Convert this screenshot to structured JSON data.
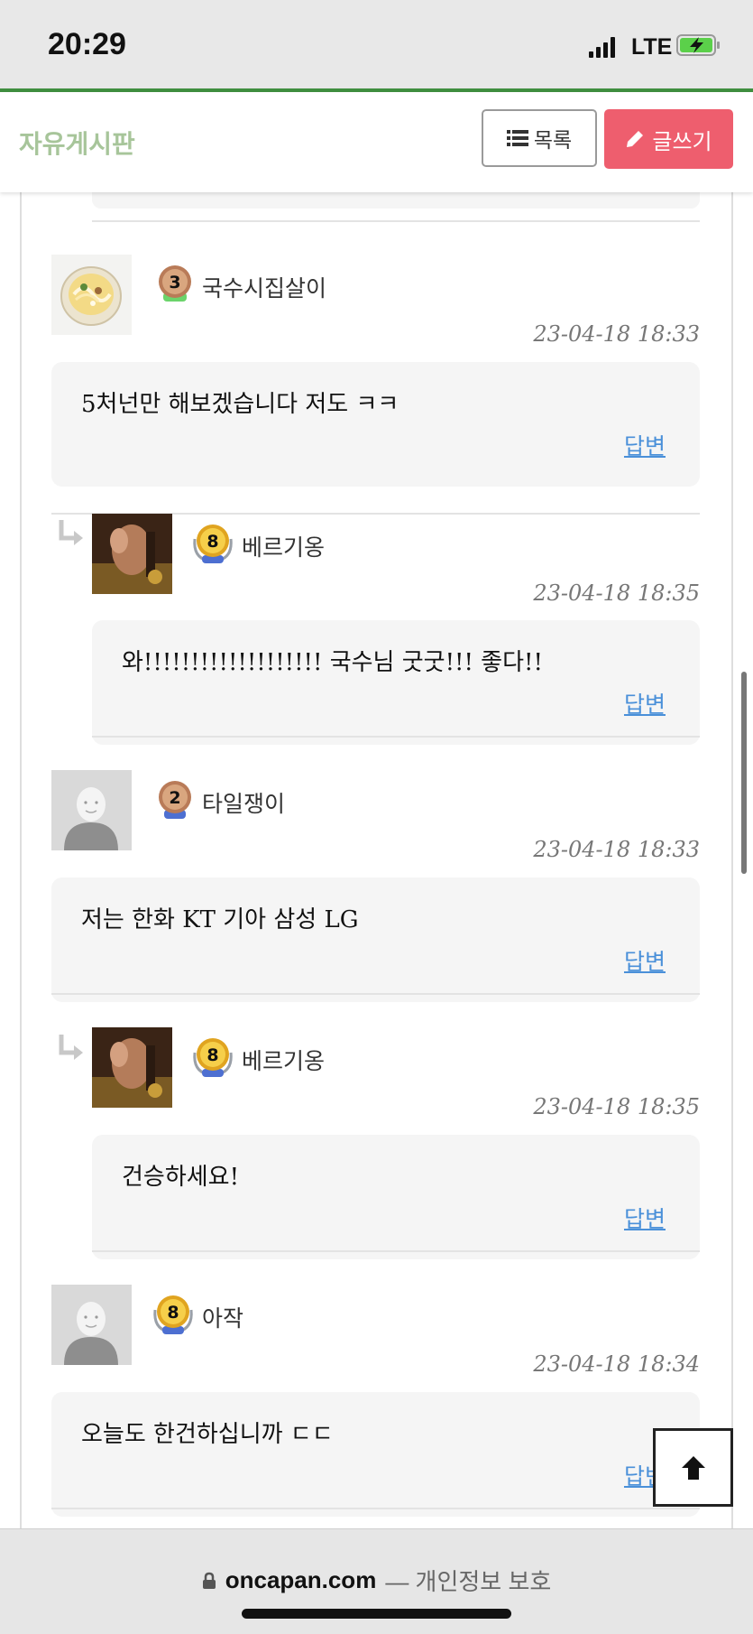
{
  "status_bar": {
    "time": "20:29",
    "network": "LTE"
  },
  "header": {
    "title": "자유게시판",
    "list_label": "목록",
    "write_label": "글쓰기"
  },
  "comments": [
    {
      "author": "국수시집살이",
      "level": "3",
      "date": "23-04-18 18:33",
      "text": "5처넌만 해보겠습니다 저도 ㅋㅋ",
      "reply_label": "답변",
      "avatar": "noodle-bowl",
      "is_reply": false
    },
    {
      "author": "베르기옹",
      "level": "8",
      "date": "23-04-18 18:35",
      "text": "와!!!!!!!!!!!!!!!!!!! 국수님 굿굿!!! 좋다!!",
      "reply_label": "답변",
      "avatar": "photo-hands",
      "is_reply": true
    },
    {
      "author": "타일쟁이",
      "level": "2",
      "date": "23-04-18 18:33",
      "text": "저는 한화 KT 기아 삼성 LG",
      "reply_label": "답변",
      "avatar": "default-user",
      "is_reply": false
    },
    {
      "author": "베르기옹",
      "level": "8",
      "date": "23-04-18 18:35",
      "text": "건승하세요!",
      "reply_label": "답변",
      "avatar": "photo-hands",
      "is_reply": true
    },
    {
      "author": "아작",
      "level": "8",
      "date": "23-04-18 18:34",
      "text": "오늘도 한건하십니까 ㄷㄷ",
      "reply_label": "답변",
      "avatar": "default-user",
      "is_reply": false
    }
  ],
  "browser": {
    "domain": "oncapan.com",
    "privacy": "— 개인정보 보호"
  },
  "colors": {
    "accent_green": "#3f8e3f",
    "write_button": "#ee5e6e",
    "reply_link": "#4a90d9",
    "title": "#a7c59a"
  }
}
